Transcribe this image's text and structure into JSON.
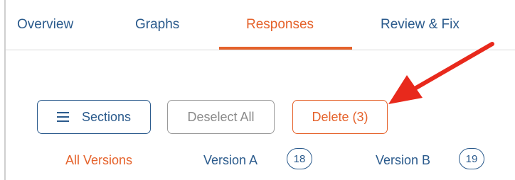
{
  "tabs": [
    {
      "label": "Overview"
    },
    {
      "label": "Graphs"
    },
    {
      "label": "Responses",
      "active": true
    },
    {
      "label": "Review & Fix"
    }
  ],
  "toolbar": {
    "sections_label": "Sections",
    "deselect_label": "Deselect All",
    "delete_label": "Delete (3)"
  },
  "versions": [
    {
      "label": "All Versions",
      "active": true
    },
    {
      "label": "Version A",
      "count": "18"
    },
    {
      "label": "Version B",
      "count": "19"
    }
  ],
  "colors": {
    "accent": "#e5622b",
    "primary": "#2a5a8c",
    "disabled": "#9a9a9a",
    "annotation_arrow": "#e8291c"
  },
  "icons": {
    "sections": "menu-icon"
  }
}
